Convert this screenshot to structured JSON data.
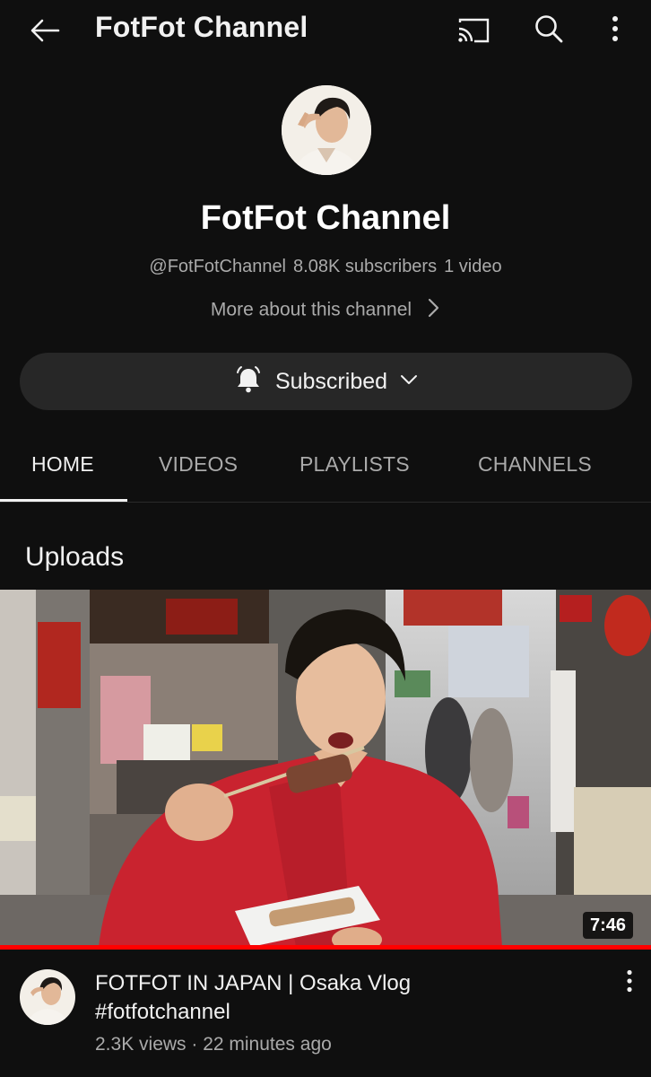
{
  "topbar": {
    "title": "FotFot Channel",
    "icons": [
      "back-arrow-icon",
      "cast-icon",
      "search-icon",
      "more-vert-icon"
    ]
  },
  "channel": {
    "name": "FotFot Channel",
    "handle": "@FotFotChannel",
    "subscribers": "8.08K subscribers",
    "videos": "1 video",
    "more_about": "More about this channel"
  },
  "subscribe": {
    "label": "Subscribed",
    "icons": [
      "bell-icon",
      "chevron-down-icon"
    ]
  },
  "tabs": [
    {
      "label": "HOME",
      "active": true
    },
    {
      "label": "VIDEOS",
      "active": false
    },
    {
      "label": "PLAYLISTS",
      "active": false
    },
    {
      "label": "CHANNELS",
      "active": false
    }
  ],
  "section": {
    "title": "Uploads"
  },
  "video": {
    "title_line1": "FOTFOT IN JAPAN | Osaka Vlog",
    "title_line2": "#fotfotchannel",
    "meta": "2.3K views · 22 minutes ago",
    "duration": "7:46",
    "watched_fraction": 1.0
  },
  "colors": {
    "background": "#0f0f0f",
    "surface": "#272727",
    "text_primary": "#f1f1f1",
    "text_secondary": "#aaaaaa",
    "progress": "#ff0000"
  }
}
